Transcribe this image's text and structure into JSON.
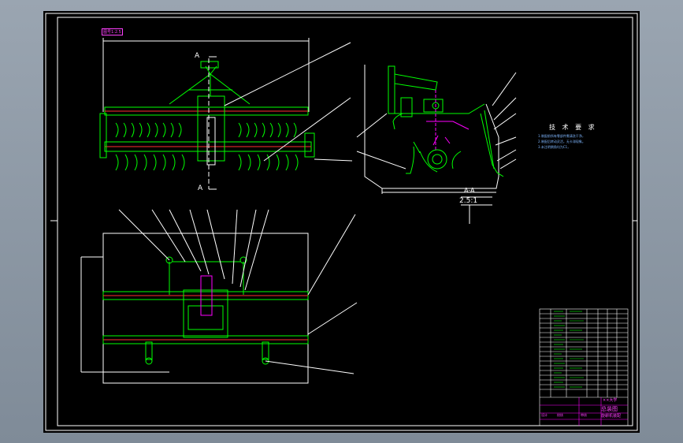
{
  "app": {
    "window": "CAD drawing viewer"
  },
  "sheet": {
    "corner_tag": "图号1:2.5",
    "section_marks": {
      "top": "A",
      "bottom": "A",
      "side_label": "A-A",
      "side_scale": "2.5:1"
    },
    "tech_requirements": {
      "title": "技 术 要 求",
      "lines": [
        "1.装配前所有零部件需清洗干净，",
        "2.装配后转动灵活，无卡滞现象。",
        "3.未注明倒角均为C1，"
      ]
    },
    "title_block": {
      "part_name": "总装图",
      "drawing_no": "旋耕机装配",
      "label_left": "设计",
      "label_mid": "校核",
      "label_right": "审核",
      "school": "××大学"
    }
  },
  "colors": {
    "background": "#000000",
    "geometry": "#00ff00",
    "dimension": "#ffffff",
    "hidden": "#ff00ff",
    "accent_red": "#ff3030",
    "frame": "#ffffff",
    "viewport": "#8f9aa6"
  }
}
